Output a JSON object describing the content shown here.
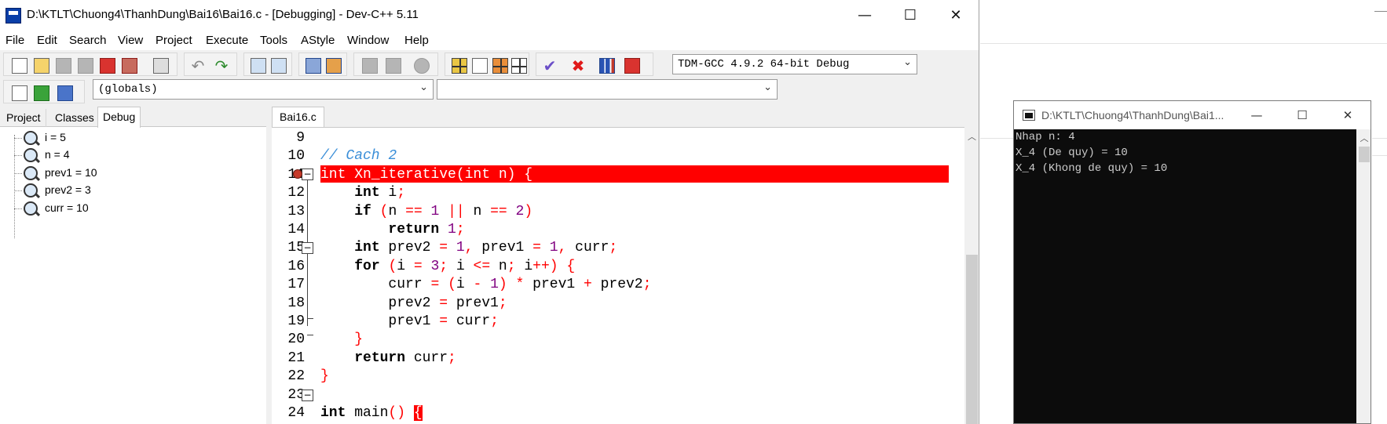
{
  "window": {
    "title": "D:\\KTLT\\Chuong4\\ThanhDung\\Bai16\\Bai16.c - [Debugging] - Dev-C++ 5.11",
    "minimize": "—",
    "maximize": "☐",
    "close": "✕"
  },
  "menu": [
    "File",
    "Edit",
    "Search",
    "View",
    "Project",
    "Execute",
    "Tools",
    "AStyle",
    "Window",
    "Help"
  ],
  "toolbar": {
    "compiler": "TDM-GCC 4.9.2 64-bit Debug",
    "scope": "(globals)",
    "member": ""
  },
  "left_panel": {
    "tabs": [
      "Project",
      "Classes",
      "Debug"
    ],
    "active_tab": "Debug",
    "watches": [
      "i = 5",
      "n = 4",
      "prev1 = 10",
      "prev2 = 3",
      "curr = 10"
    ]
  },
  "editor": {
    "tab": "Bai16.c",
    "lines": [
      {
        "n": "9",
        "html": ""
      },
      {
        "n": "10",
        "html": "<span class=\"cm\">// Cach 2</span>"
      },
      {
        "n": "11",
        "html": "<span class=\"hlt\">int Xn_iterative(int n) {</span>"
      },
      {
        "n": "12",
        "html": "    <span class=\"kw\">int</span> i<span class=\"op\">;</span>"
      },
      {
        "n": "13",
        "html": "    <span class=\"kw\">if</span> <span class=\"op\">(</span>n <span class=\"op\">==</span> <span class=\"num\">1</span> <span class=\"op\">||</span> n <span class=\"op\">==</span> <span class=\"num\">2</span><span class=\"op\">)</span>"
      },
      {
        "n": "14",
        "html": "        <span class=\"kw\">return</span> <span class=\"num\">1</span><span class=\"op\">;</span>"
      },
      {
        "n": "15",
        "html": "    <span class=\"kw\">int</span> prev2 <span class=\"op\">=</span> <span class=\"num\">1</span><span class=\"op\">,</span> prev1 <span class=\"op\">=</span> <span class=\"num\">1</span><span class=\"op\">,</span> curr<span class=\"op\">;</span>"
      },
      {
        "n": "16",
        "html": "    <span class=\"kw\">for</span> <span class=\"op\">(</span>i <span class=\"op\">=</span> <span class=\"num\">3</span><span class=\"op\">;</span> i <span class=\"op\">&lt;=</span> n<span class=\"op\">;</span> i<span class=\"op\">++)</span> <span class=\"op\">{</span>"
      },
      {
        "n": "17",
        "html": "        curr <span class=\"op\">=</span> <span class=\"op\">(</span>i <span class=\"op\">-</span> <span class=\"num\">1</span><span class=\"op\">)</span> <span class=\"op\">*</span> prev1 <span class=\"op\">+</span> prev2<span class=\"op\">;</span>"
      },
      {
        "n": "18",
        "html": "        prev2 <span class=\"op\">=</span> prev1<span class=\"op\">;</span>"
      },
      {
        "n": "19",
        "html": "        prev1 <span class=\"op\">=</span> curr<span class=\"op\">;</span>"
      },
      {
        "n": "20",
        "html": "    <span class=\"op\">}</span>"
      },
      {
        "n": "21",
        "html": "    <span class=\"kw\">return</span> curr<span class=\"op\">;</span>"
      },
      {
        "n": "22",
        "html": "<span class=\"op\">}</span>"
      },
      {
        "n": "23",
        "html": ""
      },
      {
        "n": "24",
        "html": "<span class=\"kw\">int</span> main<span class=\"op\">()</span> <span class=\"op\" style=\"background:#ff0000;color:#fff\">{</span>"
      }
    ]
  },
  "console": {
    "title": "D:\\KTLT\\Chuong4\\ThanhDung\\Bai1...",
    "output": [
      "Nhap n: 4",
      "X_4 (De quy) = 10",
      "X_4 (Khong de quy) = 10"
    ]
  }
}
